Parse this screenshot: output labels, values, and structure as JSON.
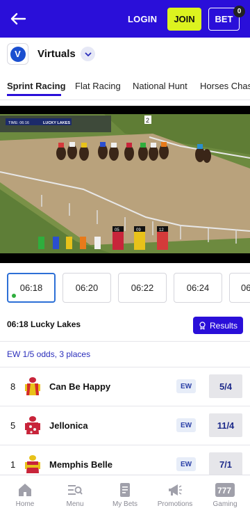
{
  "header": {
    "login_label": "LOGIN",
    "join_label": "JOIN",
    "bet_label": "BET",
    "bet_count": "0",
    "accent_color": "#2a0fd9",
    "join_color": "#dcf31f"
  },
  "product": {
    "logo_letter": "V",
    "name": "Virtuals"
  },
  "tabs": [
    {
      "label": "Sprint Racing",
      "active": true
    },
    {
      "label": "Flat Racing",
      "active": false
    },
    {
      "label": "National Hunt",
      "active": false
    },
    {
      "label": "Horses Chas",
      "active": false
    }
  ],
  "video": {
    "overlay_time": "TIME: 06:16",
    "overlay_track": "LUCKY LAKES",
    "saddle_numbers": [
      "05",
      "09",
      "12"
    ],
    "post_number": "2"
  },
  "race_times": [
    {
      "label": "06:18",
      "selected": true,
      "live": true
    },
    {
      "label": "06:20",
      "selected": false
    },
    {
      "label": "06:22",
      "selected": false
    },
    {
      "label": "06:24",
      "selected": false
    },
    {
      "label": "06",
      "selected": false
    }
  ],
  "race": {
    "title": "06:18 Lucky Lakes",
    "results_label": "Results",
    "ew_terms": "EW 1/5 odds, 3 places"
  },
  "runners": [
    {
      "number": "8",
      "name": "Can Be Happy",
      "ew": "EW",
      "odds": "5/4",
      "silk_colors": [
        "#e8c21a",
        "#d42a2a"
      ]
    },
    {
      "number": "5",
      "name": "Jellonica",
      "ew": "EW",
      "odds": "11/4",
      "silk_colors": [
        "#c8243a",
        "#f0f0f0"
      ]
    },
    {
      "number": "1",
      "name": "Memphis Belle",
      "ew": "EW",
      "odds": "7/1",
      "silk_colors": [
        "#e8c21a",
        "#c8243a"
      ]
    }
  ],
  "bottom_nav": [
    {
      "label": "Home",
      "icon": "home-icon"
    },
    {
      "label": "Menu",
      "icon": "menu-search-icon"
    },
    {
      "label": "My Bets",
      "icon": "betslip-icon"
    },
    {
      "label": "Promotions",
      "icon": "megaphone-icon"
    },
    {
      "label": "Gaming",
      "icon": "slot-777-icon"
    }
  ]
}
